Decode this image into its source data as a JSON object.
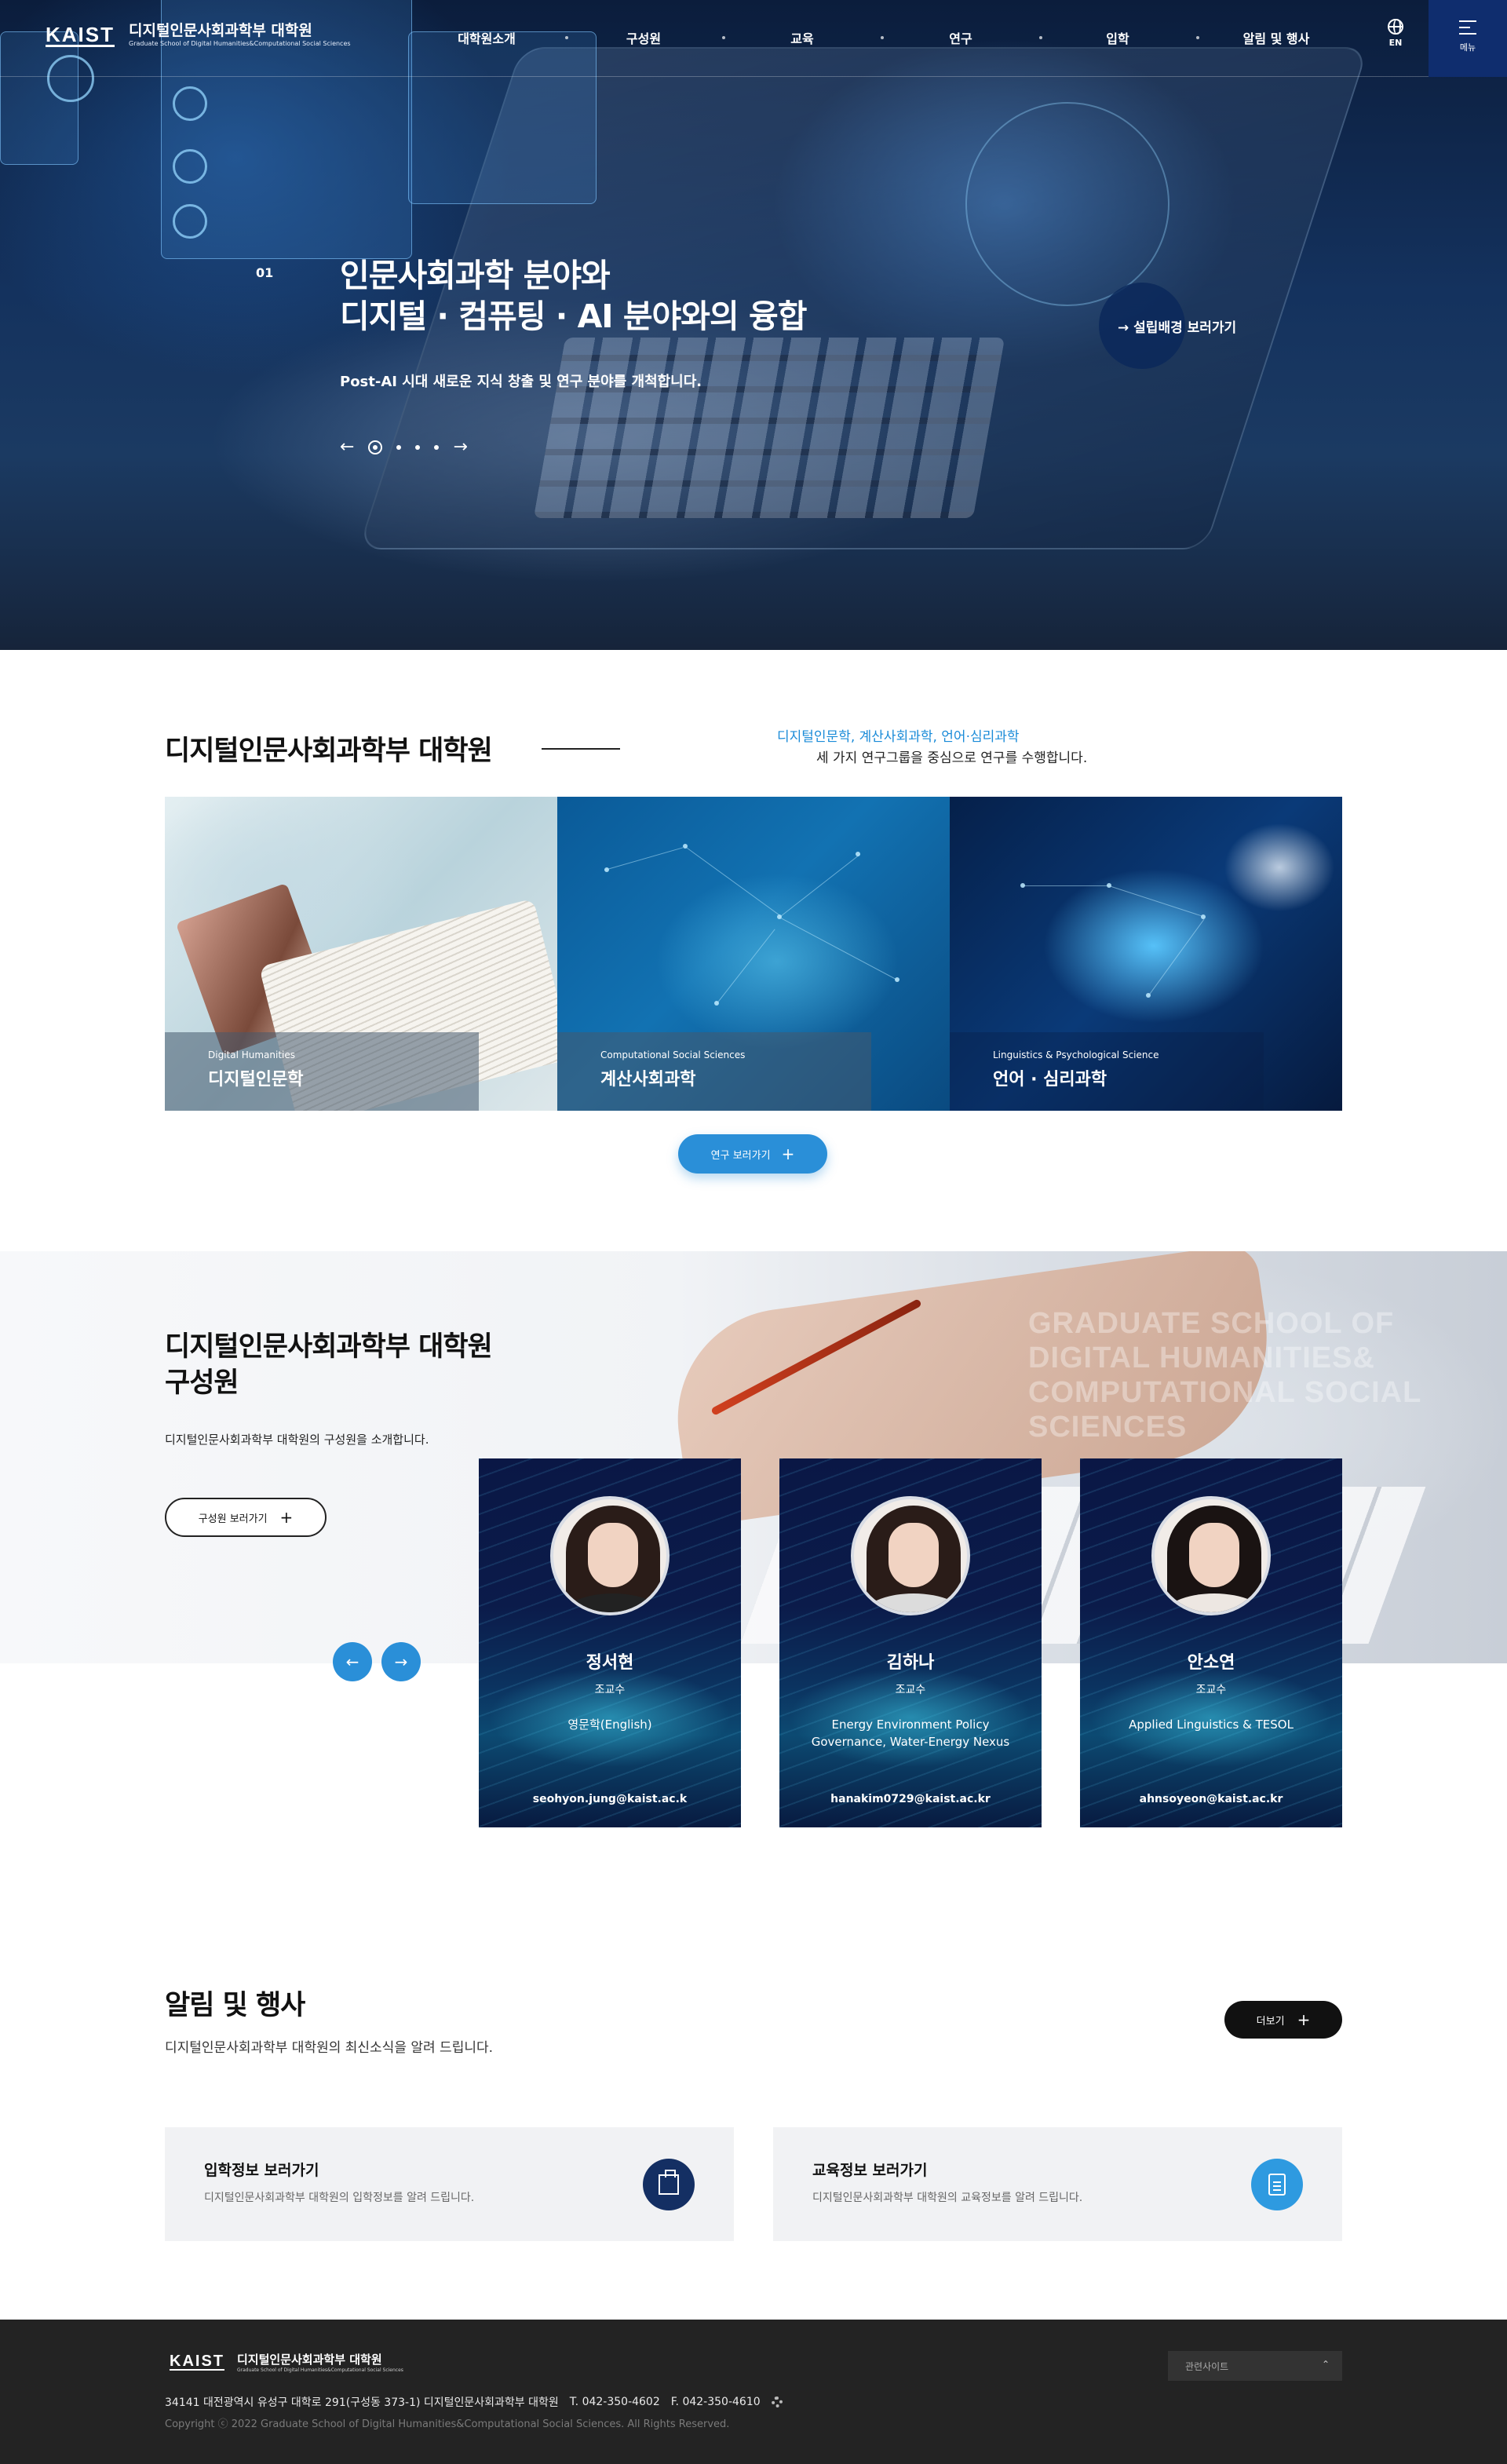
{
  "header": {
    "logo_mark": "KAIST",
    "logo_title": "디지털인문사회과학부 대학원",
    "logo_subtitle": "Graduate School of Digital Humanities&Computational Social Sciences",
    "nav": [
      "대학원소개",
      "구성원",
      "교육",
      "연구",
      "입학",
      "알림 및 행사"
    ],
    "lang_label": "EN",
    "menu_label": "메뉴",
    "icons": {
      "lang": "globe-icon",
      "menu": "hamburger-icon"
    }
  },
  "hero": {
    "slide_number": "01",
    "title_line1": "인문사회과학 분야와",
    "title_line2": "디지털 · 컴퓨팅 · AI 분야와의 융합",
    "subtitle": "Post-AI 시대 새로운 지식 창출 및 연구 분야를 개척합니다.",
    "prev_arrow": "←",
    "next_arrow": "→",
    "slide_count": 5,
    "active_slide": 1,
    "cta_label": "→ 설립배경 보러가기"
  },
  "intro": {
    "title": "디지털인문사회과학부 대학원",
    "desc_highlight": "디지털인문학, 계산사회과학, 언어·심리과학",
    "desc_text": "세 가지 연구그룹을 중심으로 연구를 수행합니다.",
    "cards": [
      {
        "en": "Digital Humanities",
        "ko": "디지털인문학"
      },
      {
        "en": "Computational Social Sciences",
        "ko": "계산사회과학"
      },
      {
        "en": "Linguistics & Psychological Science",
        "ko": "언어 · 심리과학"
      }
    ],
    "button_label": "연구 보러가기",
    "button_icon": "+"
  },
  "people": {
    "title_line1": "디지털인문사회과학부 대학원",
    "title_line2": "구성원",
    "desc": "디지털인문사회과학부 대학원의 구성원을 소개합니다.",
    "button_label": "구성원 보러가기",
    "button_icon": "+",
    "prev": "←",
    "next": "→",
    "bg_text": [
      "GRADUATE SCHOOL OF",
      "DIGITAL HUMANITIES&",
      "COMPUTATIONAL SOCIAL SCIENCES"
    ],
    "members": [
      {
        "name": "정서현",
        "role": "조교수",
        "field": "영문학(English)",
        "email": "seohyon.jung@kaist.ac.k"
      },
      {
        "name": "김하나",
        "role": "조교수",
        "field": "Energy Environment Policy Governance, Water-Energy Nexus",
        "email": "hanakim0729@kaist.ac.kr"
      },
      {
        "name": "안소연",
        "role": "조교수",
        "field": "Applied Linguistics & TESOL",
        "email": "ahnsoyeon@kaist.ac.kr"
      }
    ]
  },
  "news": {
    "title": "알림 및 행사",
    "desc": "디지털인문사회과학부 대학원의 최신소식을 알려 드립니다.",
    "more_label": "더보기",
    "more_icon": "+",
    "boxes": [
      {
        "title": "입학정보 보러가기",
        "desc": "디지털인문사회과학부 대학원의 입학정보를 알려 드립니다.",
        "icon": "building-icon",
        "color": "#142f63"
      },
      {
        "title": "교육정보 보러가기",
        "desc": "디지털인문사회과학부 대학원의 교육정보를 알려 드립니다.",
        "icon": "document-icon",
        "color": "#2e9ae0"
      }
    ]
  },
  "footer": {
    "logo_mark": "KAIST",
    "logo_title": "디지털인문사회과학부 대학원",
    "logo_subtitle": "Graduate School of Digital Humanities&Computational Social Sciences",
    "address": "34141 대전광역시 유성구 대학로 291(구성동 373-1) 디지털인문사회과학부 대학원",
    "tel": "T. 042-350-4602",
    "fax": "F. 042-350-4610",
    "copyright": "Copyright ⓒ 2022 Graduate School of Digital Humanities&Computational Social Sciences. All Rights Reserved.",
    "family_site": "관련사이트",
    "family_chevron": "⌃"
  }
}
